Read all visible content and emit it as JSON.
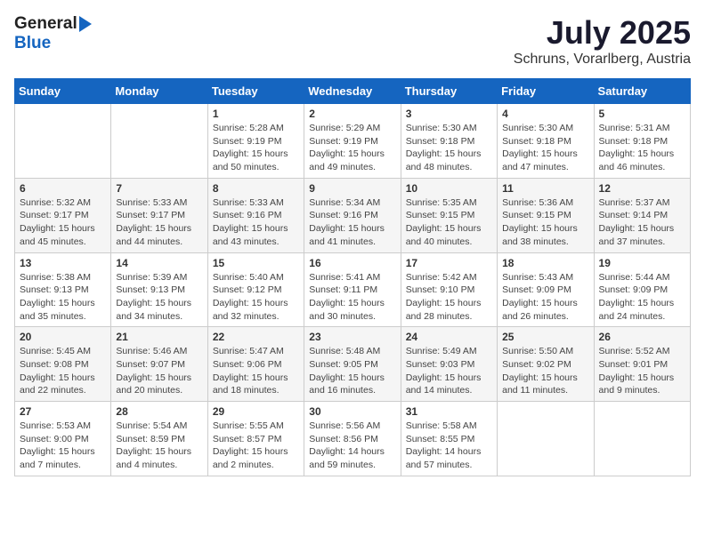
{
  "header": {
    "logo_general": "General",
    "logo_blue": "Blue",
    "month_title": "July 2025",
    "location": "Schruns, Vorarlberg, Austria"
  },
  "days_of_week": [
    "Sunday",
    "Monday",
    "Tuesday",
    "Wednesday",
    "Thursday",
    "Friday",
    "Saturday"
  ],
  "weeks": [
    [
      {
        "day": "",
        "info": ""
      },
      {
        "day": "",
        "info": ""
      },
      {
        "day": "1",
        "info": "Sunrise: 5:28 AM\nSunset: 9:19 PM\nDaylight: 15 hours\nand 50 minutes."
      },
      {
        "day": "2",
        "info": "Sunrise: 5:29 AM\nSunset: 9:19 PM\nDaylight: 15 hours\nand 49 minutes."
      },
      {
        "day": "3",
        "info": "Sunrise: 5:30 AM\nSunset: 9:18 PM\nDaylight: 15 hours\nand 48 minutes."
      },
      {
        "day": "4",
        "info": "Sunrise: 5:30 AM\nSunset: 9:18 PM\nDaylight: 15 hours\nand 47 minutes."
      },
      {
        "day": "5",
        "info": "Sunrise: 5:31 AM\nSunset: 9:18 PM\nDaylight: 15 hours\nand 46 minutes."
      }
    ],
    [
      {
        "day": "6",
        "info": "Sunrise: 5:32 AM\nSunset: 9:17 PM\nDaylight: 15 hours\nand 45 minutes."
      },
      {
        "day": "7",
        "info": "Sunrise: 5:33 AM\nSunset: 9:17 PM\nDaylight: 15 hours\nand 44 minutes."
      },
      {
        "day": "8",
        "info": "Sunrise: 5:33 AM\nSunset: 9:16 PM\nDaylight: 15 hours\nand 43 minutes."
      },
      {
        "day": "9",
        "info": "Sunrise: 5:34 AM\nSunset: 9:16 PM\nDaylight: 15 hours\nand 41 minutes."
      },
      {
        "day": "10",
        "info": "Sunrise: 5:35 AM\nSunset: 9:15 PM\nDaylight: 15 hours\nand 40 minutes."
      },
      {
        "day": "11",
        "info": "Sunrise: 5:36 AM\nSunset: 9:15 PM\nDaylight: 15 hours\nand 38 minutes."
      },
      {
        "day": "12",
        "info": "Sunrise: 5:37 AM\nSunset: 9:14 PM\nDaylight: 15 hours\nand 37 minutes."
      }
    ],
    [
      {
        "day": "13",
        "info": "Sunrise: 5:38 AM\nSunset: 9:13 PM\nDaylight: 15 hours\nand 35 minutes."
      },
      {
        "day": "14",
        "info": "Sunrise: 5:39 AM\nSunset: 9:13 PM\nDaylight: 15 hours\nand 34 minutes."
      },
      {
        "day": "15",
        "info": "Sunrise: 5:40 AM\nSunset: 9:12 PM\nDaylight: 15 hours\nand 32 minutes."
      },
      {
        "day": "16",
        "info": "Sunrise: 5:41 AM\nSunset: 9:11 PM\nDaylight: 15 hours\nand 30 minutes."
      },
      {
        "day": "17",
        "info": "Sunrise: 5:42 AM\nSunset: 9:10 PM\nDaylight: 15 hours\nand 28 minutes."
      },
      {
        "day": "18",
        "info": "Sunrise: 5:43 AM\nSunset: 9:09 PM\nDaylight: 15 hours\nand 26 minutes."
      },
      {
        "day": "19",
        "info": "Sunrise: 5:44 AM\nSunset: 9:09 PM\nDaylight: 15 hours\nand 24 minutes."
      }
    ],
    [
      {
        "day": "20",
        "info": "Sunrise: 5:45 AM\nSunset: 9:08 PM\nDaylight: 15 hours\nand 22 minutes."
      },
      {
        "day": "21",
        "info": "Sunrise: 5:46 AM\nSunset: 9:07 PM\nDaylight: 15 hours\nand 20 minutes."
      },
      {
        "day": "22",
        "info": "Sunrise: 5:47 AM\nSunset: 9:06 PM\nDaylight: 15 hours\nand 18 minutes."
      },
      {
        "day": "23",
        "info": "Sunrise: 5:48 AM\nSunset: 9:05 PM\nDaylight: 15 hours\nand 16 minutes."
      },
      {
        "day": "24",
        "info": "Sunrise: 5:49 AM\nSunset: 9:03 PM\nDaylight: 15 hours\nand 14 minutes."
      },
      {
        "day": "25",
        "info": "Sunrise: 5:50 AM\nSunset: 9:02 PM\nDaylight: 15 hours\nand 11 minutes."
      },
      {
        "day": "26",
        "info": "Sunrise: 5:52 AM\nSunset: 9:01 PM\nDaylight: 15 hours\nand 9 minutes."
      }
    ],
    [
      {
        "day": "27",
        "info": "Sunrise: 5:53 AM\nSunset: 9:00 PM\nDaylight: 15 hours\nand 7 minutes."
      },
      {
        "day": "28",
        "info": "Sunrise: 5:54 AM\nSunset: 8:59 PM\nDaylight: 15 hours\nand 4 minutes."
      },
      {
        "day": "29",
        "info": "Sunrise: 5:55 AM\nSunset: 8:57 PM\nDaylight: 15 hours\nand 2 minutes."
      },
      {
        "day": "30",
        "info": "Sunrise: 5:56 AM\nSunset: 8:56 PM\nDaylight: 14 hours\nand 59 minutes."
      },
      {
        "day": "31",
        "info": "Sunrise: 5:58 AM\nSunset: 8:55 PM\nDaylight: 14 hours\nand 57 minutes."
      },
      {
        "day": "",
        "info": ""
      },
      {
        "day": "",
        "info": ""
      }
    ]
  ]
}
